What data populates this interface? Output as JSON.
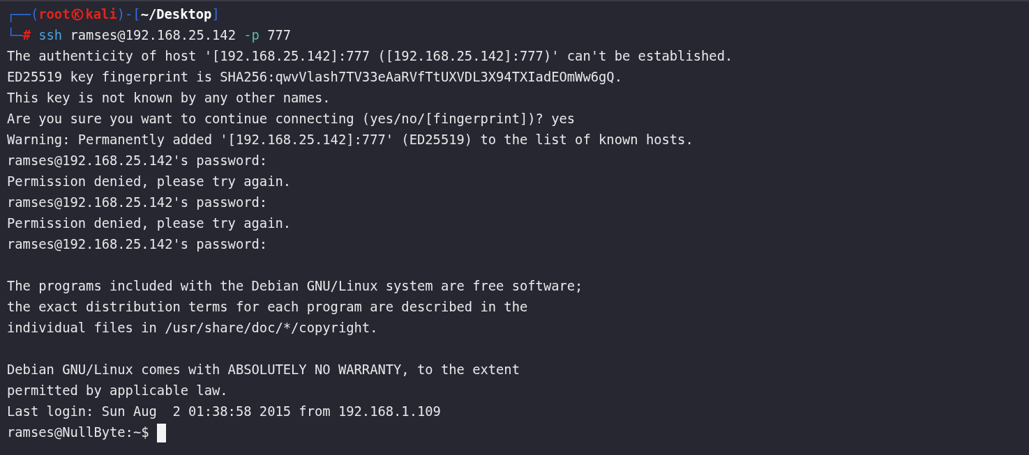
{
  "prompt": {
    "corner": "┌──(",
    "user": "root",
    "host": "kali",
    "mid": ")-[",
    "dir": "~/Desktop",
    "close": "]"
  },
  "command": {
    "corner": "└─",
    "symbol": "#",
    "program": "ssh",
    "target": "ramses@192.168.25.142",
    "flag": "-p",
    "value": "777"
  },
  "output": [
    {
      "kind": "text",
      "text": "The authenticity of host '[192.168.25.142]:777 ([192.168.25.142]:777)' can't be established."
    },
    {
      "kind": "text",
      "text": "ED25519 key fingerprint is SHA256:qwvVlash7TV33eAaRVfTtUXVDL3X94TXIadEOmWw6gQ."
    },
    {
      "kind": "text",
      "text": "This key is not known by any other names."
    },
    {
      "kind": "text",
      "text": "Are you sure you want to continue connecting (yes/no/[fingerprint])? yes"
    },
    {
      "kind": "text",
      "text": "Warning: Permanently added '[192.168.25.142]:777' (ED25519) to the list of known hosts."
    },
    {
      "kind": "text",
      "text": "ramses@192.168.25.142's password:"
    },
    {
      "kind": "text",
      "text": "Permission denied, please try again."
    },
    {
      "kind": "text",
      "text": "ramses@192.168.25.142's password:"
    },
    {
      "kind": "text",
      "text": "Permission denied, please try again."
    },
    {
      "kind": "text",
      "text": "ramses@192.168.25.142's password:"
    },
    {
      "kind": "blank"
    },
    {
      "kind": "text",
      "text": "The programs included with the Debian GNU/Linux system are free software;"
    },
    {
      "kind": "text",
      "text": "the exact distribution terms for each program are described in the"
    },
    {
      "kind": "text",
      "text": "individual files in /usr/share/doc/*/copyright."
    },
    {
      "kind": "blank"
    },
    {
      "kind": "text",
      "text": "Debian GNU/Linux comes with ABSOLUTELY NO WARRANTY, to the extent"
    },
    {
      "kind": "text",
      "text": "permitted by applicable law."
    },
    {
      "kind": "text",
      "text": "Last login: Sun Aug  2 01:38:58 2015 from 192.168.1.109"
    }
  ],
  "shell_prompt": {
    "text": "ramses@NullByte:~$",
    "cursor": true
  }
}
